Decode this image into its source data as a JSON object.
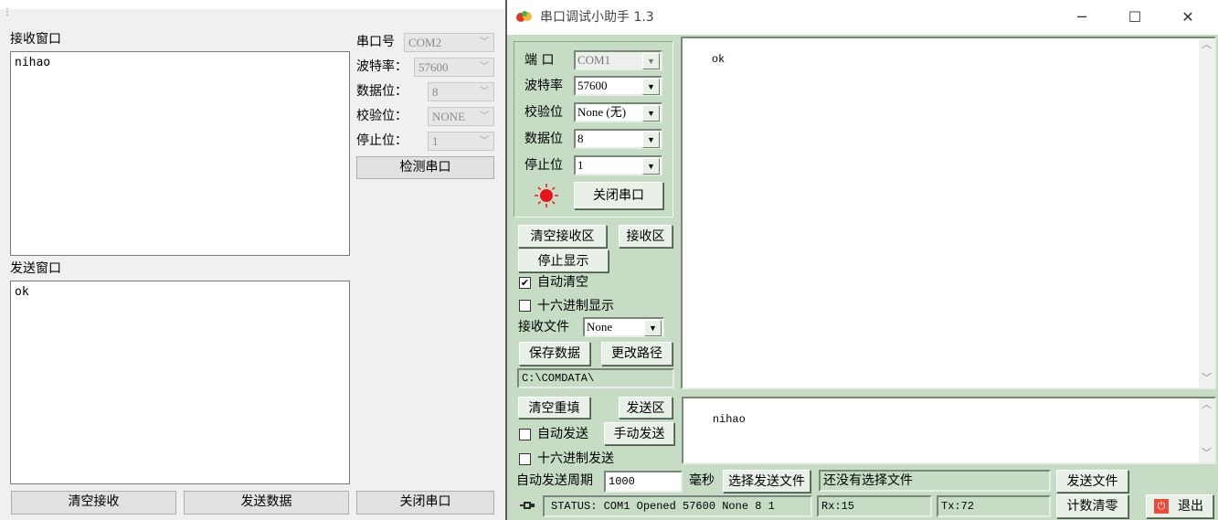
{
  "left_app": {
    "receive_label": "接收窗口",
    "receive_text": "nihao",
    "send_label": "发送窗口",
    "send_text": "ok",
    "port_label": "串口号",
    "port_value": "COM2",
    "baud_label": "波特率：",
    "baud_value": "57600",
    "databits_label": "数据位：",
    "databits_value": "8",
    "parity_label": "校验位：",
    "parity_value": "NONE",
    "stopbits_label": "停止位：",
    "stopbits_value": "1",
    "detect_button": "检测串口",
    "clear_receive_button": "清空接收",
    "send_data_button": "发送数据",
    "close_port_button": "关闭串口"
  },
  "right_app": {
    "title": "串口调试小助手 1.3",
    "window_controls": {
      "minimize": "─",
      "maximize": "☐",
      "close": "✕"
    },
    "port_label": "端 口",
    "port_value": "COM1",
    "baud_label": "波特率",
    "baud_value": "57600",
    "parity_label": "校验位",
    "parity_value": "None (无)",
    "databits_label": "数据位",
    "databits_value": "8",
    "stopbits_label": "停止位",
    "stopbits_value": "1",
    "status_light_color": "#e8141c",
    "close_port_button": "关闭串口",
    "clear_receive_button": "清空接收区",
    "receive_area_button": "接收区",
    "stop_display_button": "停止显示",
    "auto_clear_label": "自动清空",
    "auto_clear_checked": true,
    "hex_display_label": "十六进制显示",
    "hex_display_checked": false,
    "receive_file_label": "接收文件",
    "receive_file_value": "None",
    "save_data_button": "保存数据",
    "change_path_button": "更改路径",
    "path_value": "C:\\COMDATA\\",
    "receive_text": "ok",
    "clear_refill_button": "清空重填",
    "send_area_button": "发送区",
    "auto_send_label": "自动发送",
    "auto_send_checked": false,
    "manual_send_button": "手动发送",
    "hex_send_label": "十六进制发送",
    "hex_send_checked": false,
    "send_text": "nihao",
    "auto_send_period_label": "自动发送周期",
    "auto_send_period_value": "1000",
    "ms_label": "毫秒",
    "choose_send_file_button": "选择发送文件",
    "file_status": "还没有选择文件",
    "send_file_button": "发送文件",
    "status_text": "STATUS: COM1 Opened 57600 None  8 1",
    "rx_text": "Rx:15",
    "tx_text": "Tx:72",
    "reset_count_button": "计数清零",
    "exit_button": "退出"
  },
  "colors": {
    "panel_green": "#c6dcc5",
    "exit_icon_red": "#e84c3d"
  }
}
